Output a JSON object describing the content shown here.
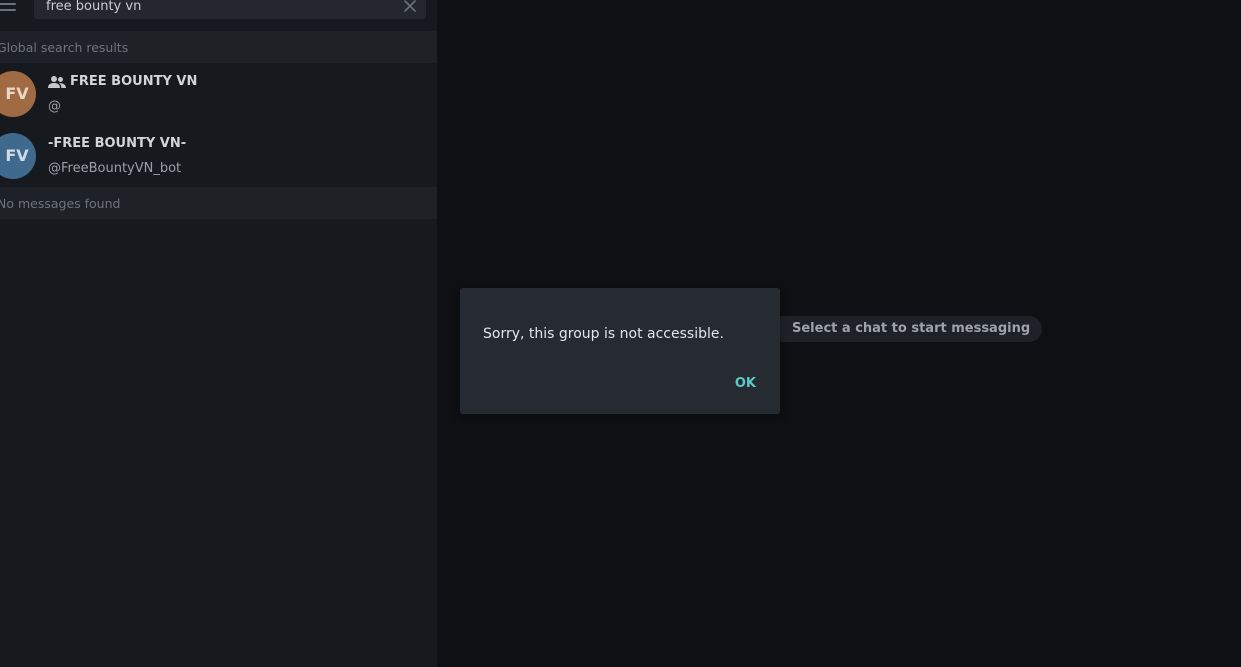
{
  "search": {
    "value": "free bounty vn"
  },
  "sections": {
    "global_results": "Global search results",
    "no_messages": "No messages found"
  },
  "results": [
    {
      "initials": "FV",
      "title": "FREE BOUNTY VN",
      "subtitle": "@",
      "avatar_color": "#a06a42",
      "is_group": true
    },
    {
      "initials": "FV",
      "title": "-FREE BOUNTY VN-",
      "subtitle": "@FreeBountyVN_bot",
      "avatar_color": "#3f6a8e",
      "is_group": false
    }
  ],
  "main": {
    "empty_text": "Select a chat to start messaging"
  },
  "dialog": {
    "message": "Sorry, this group is not accessible.",
    "ok_label": "OK"
  },
  "colors": {
    "accent": "#5fc9c8",
    "sidebar_bg": "#16191d",
    "main_bg": "#0e1013"
  },
  "icons": {
    "menu": "menu-icon",
    "clear": "close-icon",
    "group": "group-icon"
  }
}
